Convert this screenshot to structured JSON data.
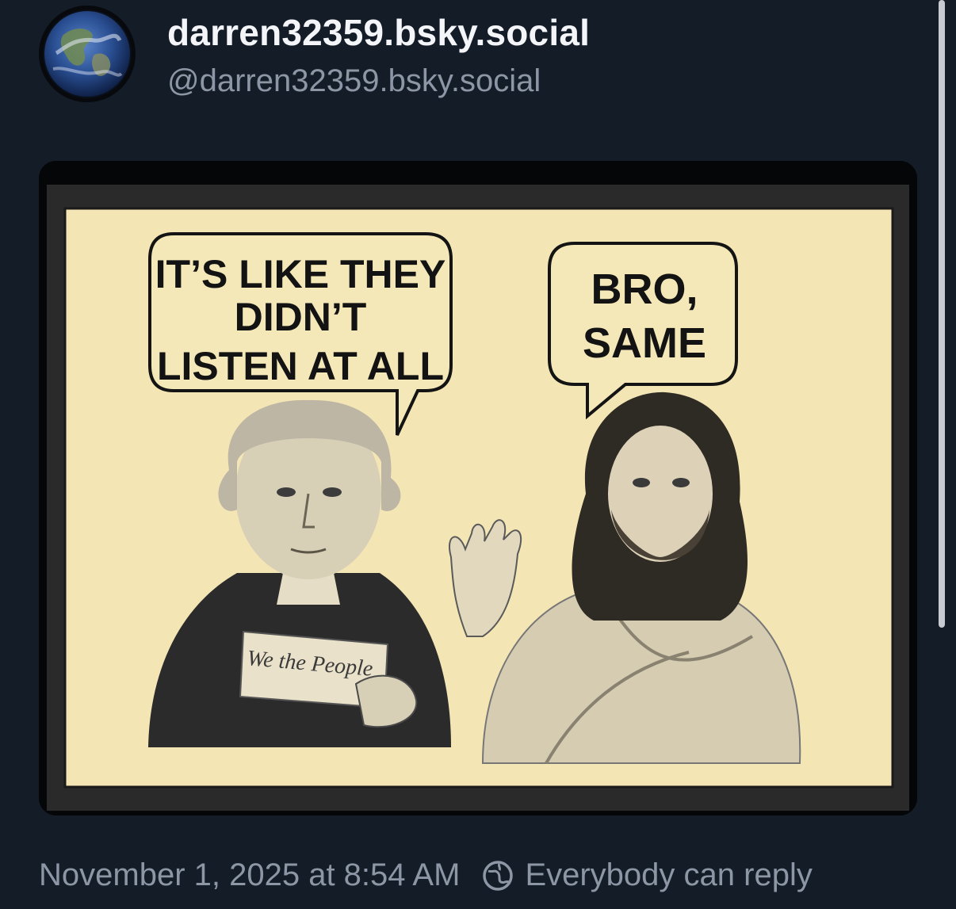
{
  "post": {
    "author": {
      "display_name": "darren32359.bsky.social",
      "handle": "@darren32359.bsky.social",
      "avatar_icon": "earth-globe-avatar"
    },
    "image": {
      "left_bubble": [
        "IT’S LIKE THEY",
        "DIDN’T",
        "LISTEN AT ALL"
      ],
      "right_bubble": [
        "BRO,",
        "SAME"
      ],
      "scroll_text": "We the People",
      "left_figure": "george-washington",
      "right_figure": "jesus"
    },
    "timestamp": "November 1, 2025 at 8:54 AM",
    "reply_setting": "Everybody can reply",
    "reply_icon": "globe-reply-icon"
  },
  "colors": {
    "background": "#141c28",
    "text_primary": "#f3f5f8",
    "text_secondary": "#8c96a4",
    "meme_paper": "#f4e6b4"
  }
}
